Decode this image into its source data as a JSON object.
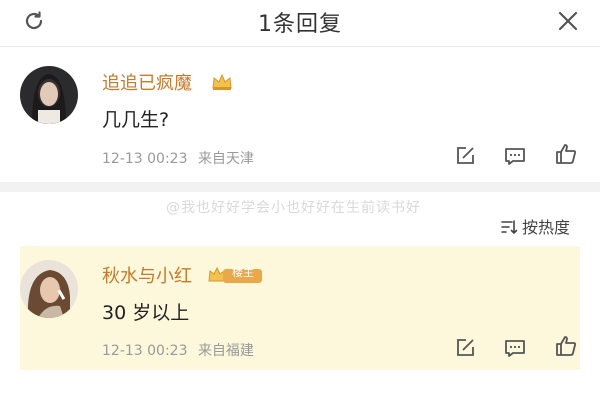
{
  "header": {
    "title": "1条回复"
  },
  "comments": [
    {
      "username": "追追已疯魔",
      "text": "几几生?",
      "time": "12-13 00:23",
      "location": "来自天津"
    },
    {
      "username": "秋水与小红",
      "badge_label": "楼主",
      "text": "30 岁以上",
      "time": "12-13 00:23",
      "location": "来自福建"
    }
  ],
  "sort": {
    "label": "按热度"
  },
  "watermark": "@我也好好学会小也好好在生前读书好",
  "colors": {
    "username": "#c77a2a",
    "highlight_bg": "#fdf8dc",
    "badge_gold": "#e9a94a"
  }
}
